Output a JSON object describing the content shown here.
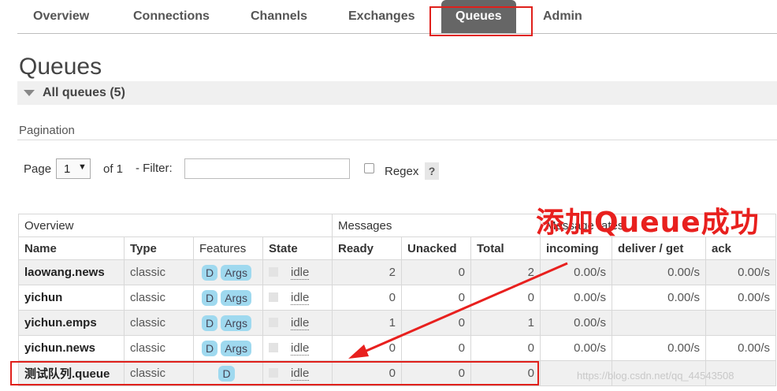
{
  "nav": {
    "items": [
      "Overview",
      "Connections",
      "Channels",
      "Exchanges",
      "Queues",
      "Admin"
    ],
    "active": "Queues"
  },
  "page": {
    "title": "Queues",
    "section_label": "All queues (5)"
  },
  "pagination": {
    "title": "Pagination",
    "page_label": "Page",
    "page_value": "1",
    "of_label": "of 1",
    "filter_label": "- Filter:",
    "filter_value": "",
    "regex_label": "Regex",
    "help": "?"
  },
  "table": {
    "groups": {
      "overview": "Overview",
      "messages": "Messages",
      "rates": "Message rates"
    },
    "columns": [
      "Name",
      "Type",
      "Features",
      "State",
      "Ready",
      "Unacked",
      "Total",
      "incoming",
      "deliver / get",
      "ack"
    ],
    "rows": [
      {
        "name": "laowang.news",
        "type": "classic",
        "features": [
          "D",
          "Args"
        ],
        "state": "idle",
        "ready": "2",
        "unacked": "0",
        "total": "2",
        "incoming": "0.00/s",
        "deliver": "0.00/s",
        "ack": "0.00/s"
      },
      {
        "name": "yichun",
        "type": "classic",
        "features": [
          "D",
          "Args"
        ],
        "state": "idle",
        "ready": "0",
        "unacked": "0",
        "total": "0",
        "incoming": "0.00/s",
        "deliver": "0.00/s",
        "ack": "0.00/s"
      },
      {
        "name": "yichun.emps",
        "type": "classic",
        "features": [
          "D",
          "Args"
        ],
        "state": "idle",
        "ready": "1",
        "unacked": "0",
        "total": "1",
        "incoming": "0.00/s",
        "deliver": "",
        "ack": ""
      },
      {
        "name": "yichun.news",
        "type": "classic",
        "features": [
          "D",
          "Args"
        ],
        "state": "idle",
        "ready": "0",
        "unacked": "0",
        "total": "0",
        "incoming": "0.00/s",
        "deliver": "0.00/s",
        "ack": "0.00/s"
      },
      {
        "name": "测试队列.queue",
        "type": "classic",
        "features": [
          "D"
        ],
        "state": "idle",
        "ready": "0",
        "unacked": "0",
        "total": "0",
        "incoming": "",
        "deliver": "",
        "ack": ""
      }
    ]
  },
  "annotation": {
    "text": "添加Queue成功",
    "color": "#e8201e"
  },
  "watermark": "https://blog.csdn.net/qq_44543508"
}
